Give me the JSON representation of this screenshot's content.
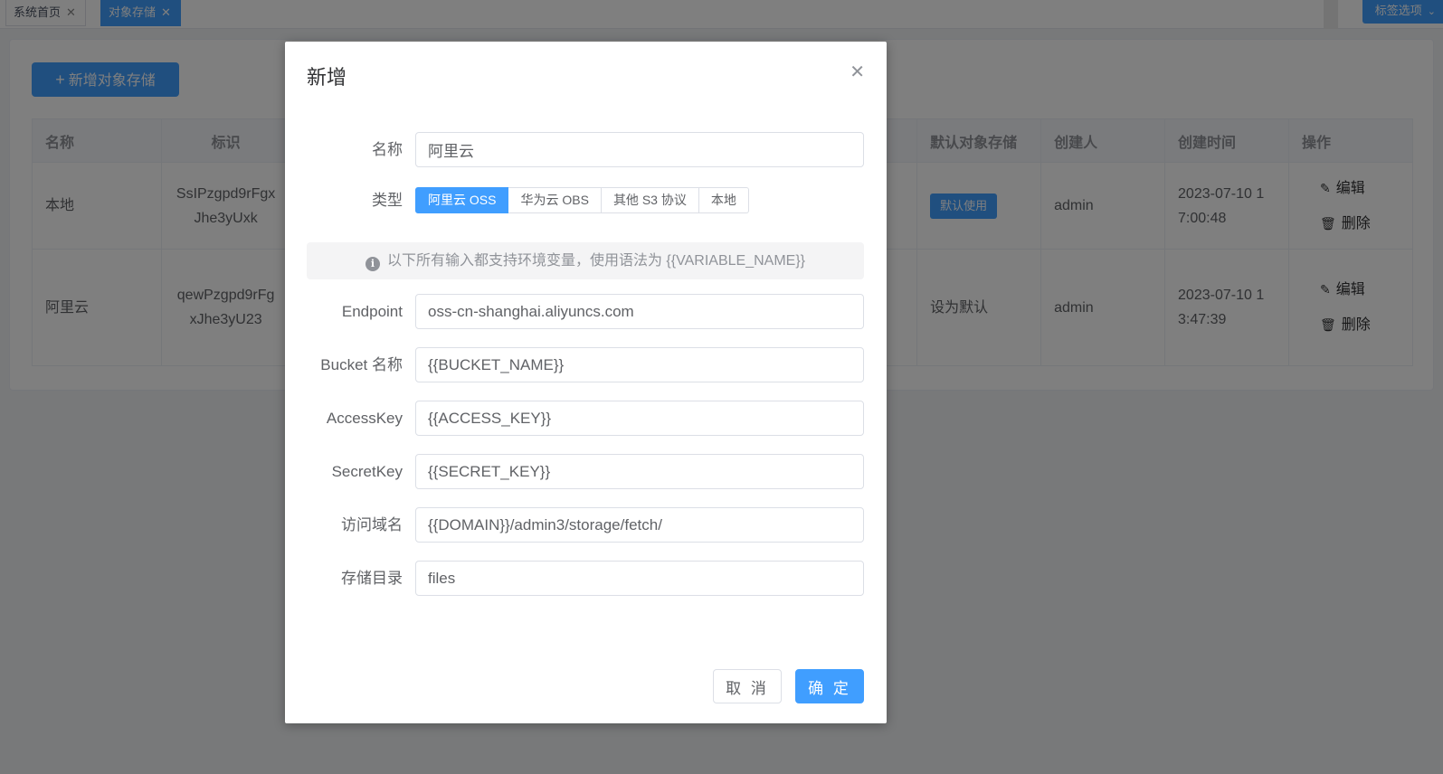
{
  "tabs": [
    {
      "label": "系统首页",
      "active": false
    },
    {
      "label": "对象存储",
      "active": true
    }
  ],
  "tabs_options": {
    "label": "标签选项"
  },
  "toolbar": {
    "add_label": "新增对象存储"
  },
  "table": {
    "headers": {
      "name": "名称",
      "identifier": "标识",
      "default": "默认对象存储",
      "creator": "创建人",
      "created_at": "创建时间",
      "actions": "操作"
    },
    "rows": [
      {
        "name": "本地",
        "id_line1": "SsIPzgpd9rFgx",
        "id_line2": "Jhe3yUxk",
        "default_badge": "默认使用",
        "creator": "admin",
        "time_line1": "2023-07-10 1",
        "time_line2": "7:00:48",
        "edit": "编辑",
        "delete": "删除"
      },
      {
        "name": "阿里云",
        "id_line1": "qewPzgpd9rFg",
        "id_line2": "xJhe3yU23",
        "default_action": "设为默认",
        "creator": "admin",
        "time_line1": "2023-07-10 1",
        "time_line2": "3:47:39",
        "edit": "编辑",
        "delete": "删除"
      }
    ]
  },
  "dialog": {
    "title": "新增",
    "fields": {
      "name": {
        "label": "名称",
        "value": "阿里云"
      },
      "type": {
        "label": "类型"
      },
      "endpoint": {
        "label": "Endpoint",
        "value": "oss-cn-shanghai.aliyuncs.com"
      },
      "bucket": {
        "label": "Bucket 名称",
        "value": "{{BUCKET_NAME}}"
      },
      "access_key": {
        "label": "AccessKey",
        "value": "{{ACCESS_KEY}}"
      },
      "secret_key": {
        "label": "SecretKey",
        "value": "{{SECRET_KEY}}"
      },
      "domain": {
        "label": "访问域名",
        "value": "{{DOMAIN}}/admin3/storage/fetch/"
      },
      "directory": {
        "label": "存储目录",
        "value": "files"
      }
    },
    "type_options": [
      {
        "label": "阿里云 OSS",
        "active": true
      },
      {
        "label": "华为云 OBS",
        "active": false
      },
      {
        "label": "其他 S3 协议",
        "active": false
      },
      {
        "label": "本地",
        "active": false
      }
    ],
    "tip": "以下所有输入都支持环境变量，使用语法为 {{VARIABLE_NAME}}",
    "cancel_label": "取 消",
    "ok_label": "确 定"
  },
  "colors": {
    "primary": "#409eff",
    "overlay": "rgba(0,0,0,0.5)"
  }
}
